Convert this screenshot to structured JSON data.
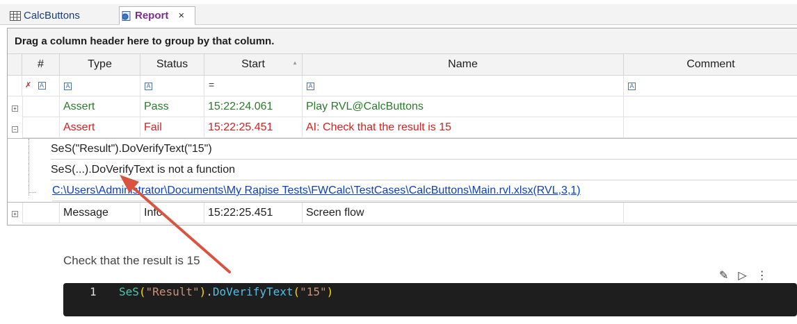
{
  "tabs": [
    {
      "label": "CalcButtons",
      "icon": "table-icon"
    },
    {
      "label": "Report",
      "icon": "report-icon",
      "close": "×"
    }
  ],
  "grid": {
    "group_hint": "Drag a column header here to group by that column.",
    "columns": [
      "#",
      "Type",
      "Status",
      "Start",
      "Name",
      "Comment"
    ],
    "filter_eq": "=",
    "rows": [
      {
        "type": "Assert",
        "status": "Pass",
        "start": "15:22:24.061",
        "name": "Play RVL@CalcButtons",
        "comment": ""
      },
      {
        "type": "Assert",
        "status": "Fail",
        "start": "15:22:25.451",
        "name": "AI: Check that the result is 15",
        "comment": ""
      },
      {
        "type": "Message",
        "status": "Info",
        "start": "15:22:25.451",
        "name": "Screen flow",
        "comment": ""
      }
    ],
    "details": [
      "SeS(\"Result\").DoVerifyText(\"15\")",
      "SeS(...).DoVerifyText is not a function",
      "C:\\Users\\Administrator\\Documents\\My Rapise Tests\\FWCalc\\TestCases\\CalcButtons\\Main.rvl.xlsx(RVL,3,1)"
    ]
  },
  "notebook": {
    "cell_title": "Check that the result is 15",
    "line_number": "1",
    "code": {
      "fn": "SeS",
      "open": "(",
      "arg1": "\"Result\"",
      "close": ")",
      "dot": ".",
      "method": "DoVerifyText",
      "arg2": "\"15\""
    }
  },
  "colors": {
    "pass": "#2b7a2b",
    "fail": "#e01b1b",
    "annotation_arrow": "#d9533f"
  }
}
